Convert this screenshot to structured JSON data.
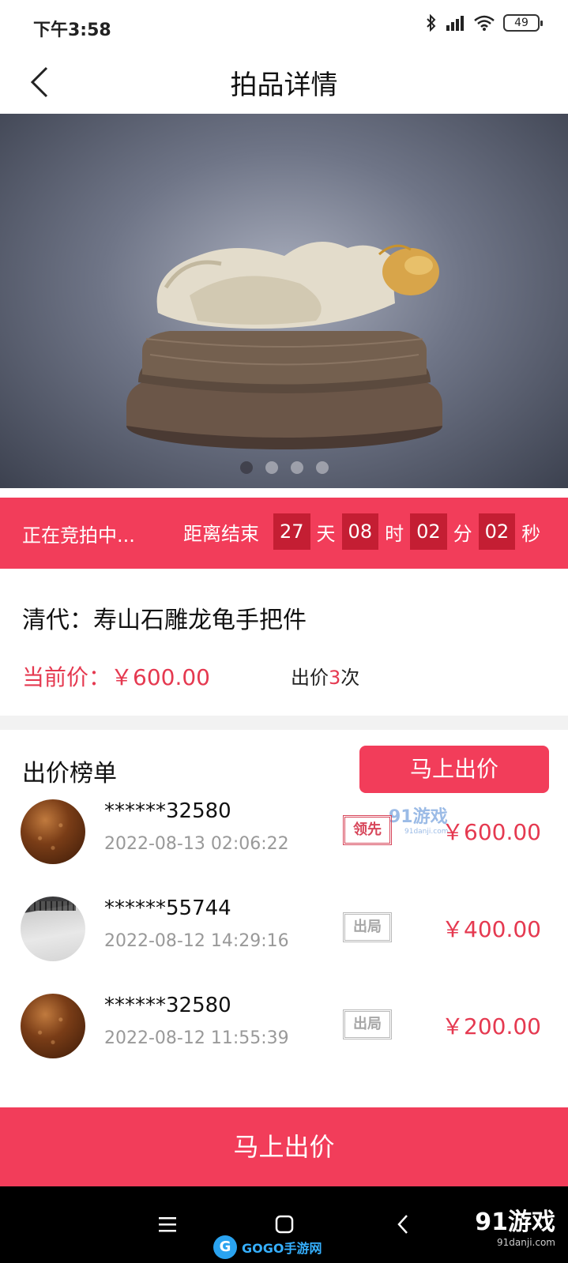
{
  "status_bar": {
    "time": "下午3:58",
    "battery": "49"
  },
  "header": {
    "title": "拍品详情"
  },
  "gallery": {
    "image_count": 4,
    "active_index": 0
  },
  "auction": {
    "status": "正在竞拍中...",
    "ends_label": "距离结束",
    "days": "27",
    "days_unit": "天",
    "hours": "08",
    "hours_unit": "时",
    "minutes": "02",
    "minutes_unit": "分",
    "seconds": "02",
    "seconds_unit": "秒"
  },
  "item": {
    "title": "清代：寿山石雕龙龟手把件",
    "current_price": "当前价：￥600.00",
    "bid_count_prefix": "出价",
    "bid_count": "3",
    "bid_count_suffix": "次"
  },
  "ranking": {
    "title": "出价榜单",
    "bid_button": "马上出价",
    "bids": [
      {
        "name": "******32580",
        "time": "2022-08-13 02:06:22",
        "status": "领先",
        "amount": "￥600.00"
      },
      {
        "name": "******55744",
        "time": "2022-08-12 14:29:16",
        "status": "出局",
        "amount": "￥400.00"
      },
      {
        "name": "******32580",
        "time": "2022-08-12 11:55:39",
        "status": "出局",
        "amount": "￥200.00"
      }
    ]
  },
  "bottom": {
    "bid_button": "马上出价"
  },
  "watermarks": {
    "mid_logo": "91游戏",
    "mid_url": "91danji.com",
    "gogo": "GOGO手游网",
    "corner_logo": "91游戏",
    "corner_url": "91danji.com"
  },
  "colors": {
    "accent": "#f23d5a",
    "accent_dark": "#c41e33",
    "price": "#e53950"
  },
  "icons": [
    "back-icon",
    "bluetooth-icon",
    "signal-icon",
    "wifi-icon",
    "battery-icon",
    "menu-icon",
    "home-icon",
    "nav-back-icon"
  ]
}
